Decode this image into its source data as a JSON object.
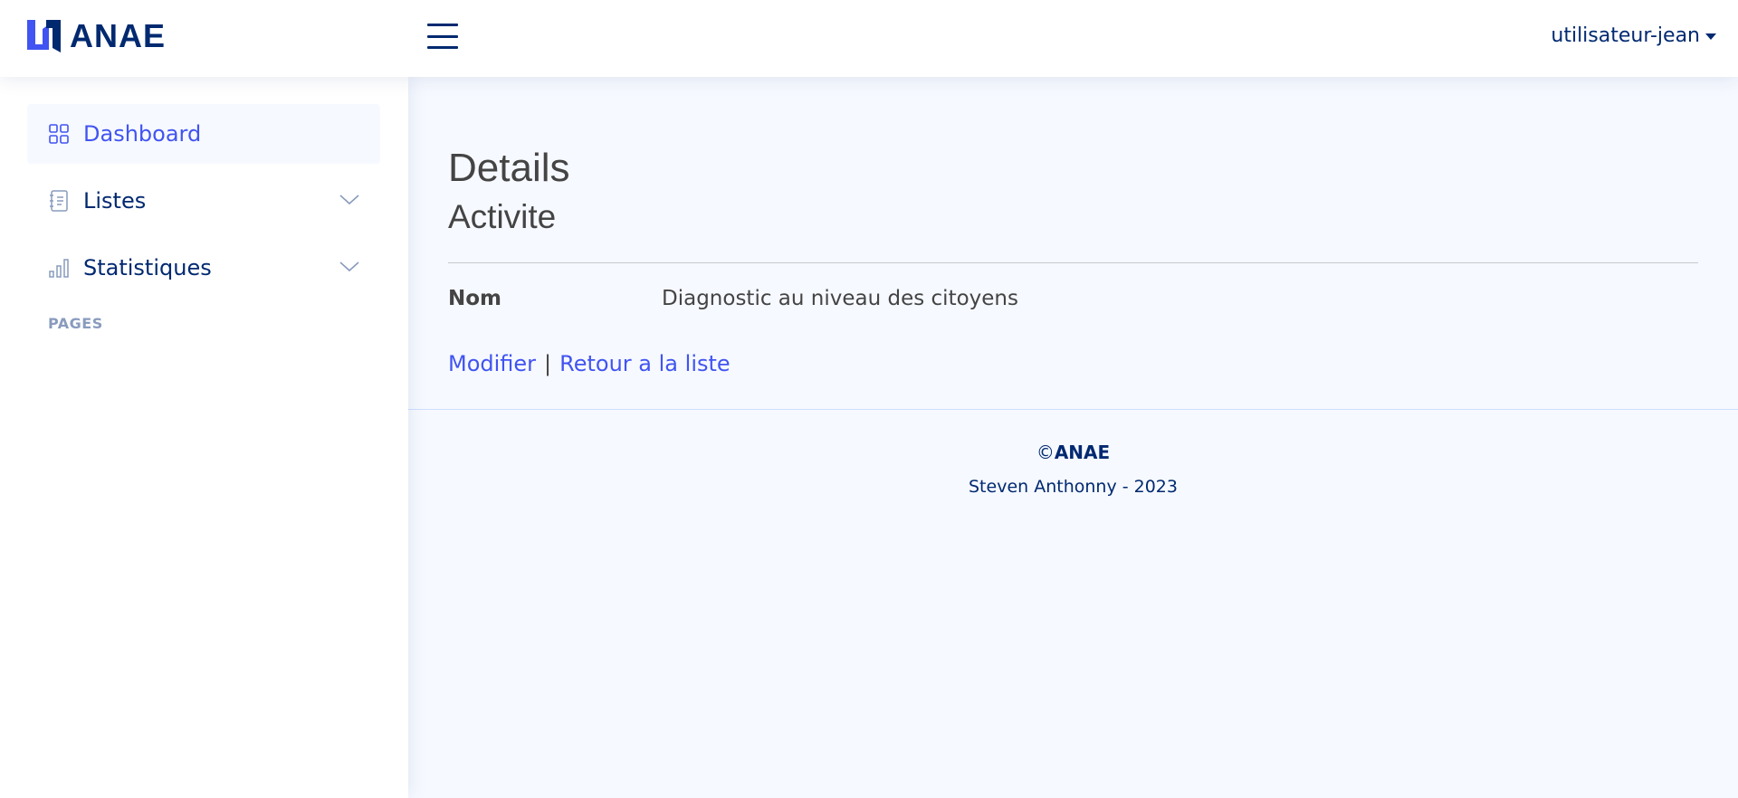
{
  "header": {
    "logo_text": "ANAE",
    "toggle_icon": "list-icon",
    "user_label": "utilisateur-jean"
  },
  "sidebar": {
    "items": [
      {
        "label": "Dashboard",
        "icon": "grid-icon",
        "active": true
      },
      {
        "label": "Listes",
        "icon": "journal-text-icon",
        "expandable": true
      },
      {
        "label": "Statistiques",
        "icon": "bar-chart-icon",
        "expandable": true
      }
    ],
    "heading": "Pages"
  },
  "main": {
    "title": "Details",
    "subtitle": "Activite",
    "fields": [
      {
        "term": "Nom",
        "value": "Diagnostic au niveau des citoyens"
      }
    ],
    "actions": {
      "edit_label": "Modifier",
      "separator": "|",
      "back_label": "Retour a la liste"
    }
  },
  "footer": {
    "copyright_symbol": "©",
    "copyright_brand": "ANAE",
    "credit": "Steven Anthonny - 2023"
  },
  "colors": {
    "primary": "#4154f1",
    "navy": "#012970",
    "muted": "#899bbd",
    "page_background": "#f6f9ff"
  }
}
